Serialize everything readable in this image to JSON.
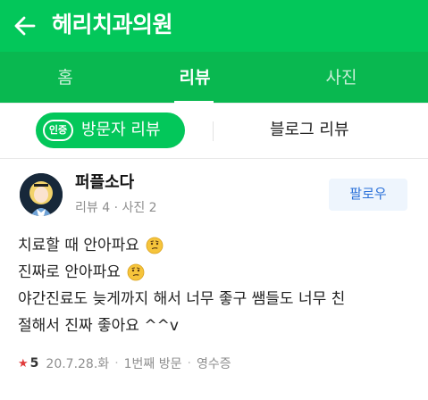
{
  "header": {
    "title": "헤리치과의원",
    "back_icon": "arrow-left-icon",
    "color": "#03c75a"
  },
  "tabs": [
    {
      "label": "홈",
      "active": false
    },
    {
      "label": "리뷰",
      "active": true
    },
    {
      "label": "사진",
      "active": false
    }
  ],
  "subtabs": {
    "badge": "인증",
    "visit_label": "방문자 리뷰",
    "blog_label": "블로그 리뷰"
  },
  "review": {
    "author": "퍼플소다",
    "author_meta": "리뷰 4 · 사진 2",
    "follow_label": "팔로우",
    "lines": [
      "치료할 때 안아파요",
      "진짜로 안아파요",
      "야간진료도 늦게까지 해서 너무 좋구 쌤들도 너무 친",
      "절해서 진짜 좋아요 ^^v"
    ],
    "emoji_icon": "thinking-face-icon",
    "rating": "5",
    "date": "20.7.28.화",
    "visit_count": "1번째 방문",
    "receipt": "영수증"
  }
}
